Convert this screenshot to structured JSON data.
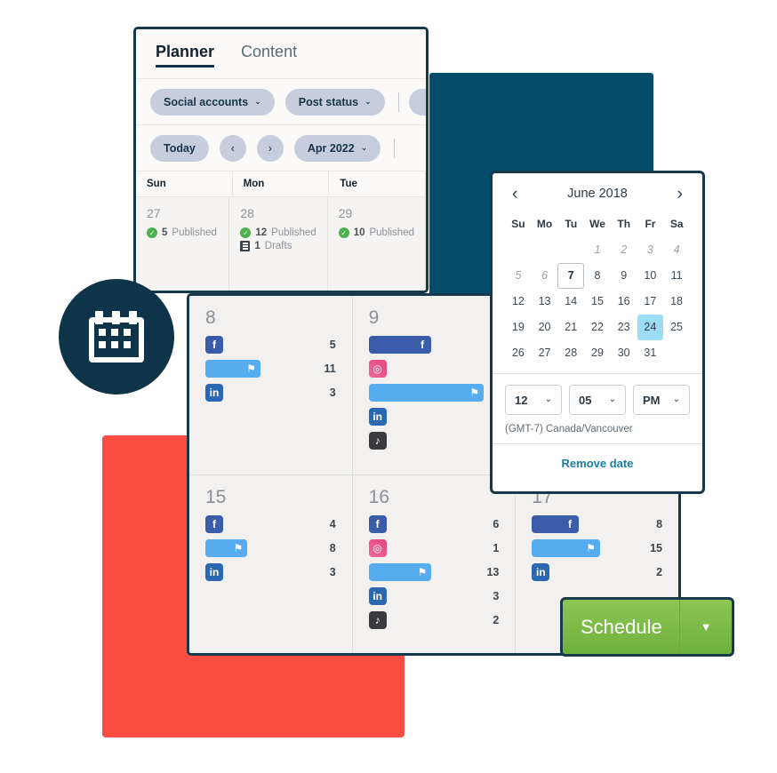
{
  "planner": {
    "tabs": [
      {
        "label": "Planner",
        "active": true
      },
      {
        "label": "Content",
        "active": false
      }
    ],
    "filters": [
      {
        "label": "Social accounts",
        "chevron": "⌄"
      },
      {
        "label": "Post status",
        "chevron": "⌄"
      }
    ],
    "nav": {
      "today_label": "Today",
      "prev_icon": "‹",
      "next_icon": "›",
      "month_label": "Apr 2022",
      "month_chevron": "⌄"
    },
    "weekday_headers": [
      "Sun",
      "Mon",
      "Tue"
    ],
    "days": [
      {
        "number": "27",
        "stats": [
          {
            "icon": "check-icon",
            "count": "5",
            "label": "Published"
          }
        ]
      },
      {
        "number": "28",
        "stats": [
          {
            "icon": "check-icon",
            "count": "12",
            "label": "Published"
          },
          {
            "icon": "draft-icon",
            "count": "1",
            "label": "Drafts"
          }
        ]
      },
      {
        "number": "29",
        "stats": [
          {
            "icon": "check-icon",
            "count": "10",
            "label": "Published"
          }
        ]
      }
    ]
  },
  "grid": {
    "cells": [
      {
        "day": "8",
        "rows": [
          {
            "network": "facebook",
            "count": "5",
            "bar_pct": 0
          },
          {
            "network": "twitter",
            "count": "11",
            "bar_pct": 42
          },
          {
            "network": "linkedin",
            "count": "3",
            "bar_pct": 0
          }
        ]
      },
      {
        "day": "9",
        "rows": [
          {
            "network": "facebook",
            "count": "",
            "bar_pct": 48
          },
          {
            "network": "instagram",
            "count": "",
            "bar_pct": 0
          },
          {
            "network": "twitter",
            "count": "",
            "bar_pct": 88
          },
          {
            "network": "linkedin",
            "count": "",
            "bar_pct": 0
          },
          {
            "network": "tiktok",
            "count": "",
            "bar_pct": 0
          }
        ]
      },
      {
        "day": "",
        "rows": []
      },
      {
        "day": "15",
        "rows": [
          {
            "network": "facebook",
            "count": "4",
            "bar_pct": 0
          },
          {
            "network": "twitter",
            "count": "8",
            "bar_pct": 32
          },
          {
            "network": "linkedin",
            "count": "3",
            "bar_pct": 0
          }
        ]
      },
      {
        "day": "16",
        "rows": [
          {
            "network": "facebook",
            "count": "6",
            "bar_pct": 0
          },
          {
            "network": "instagram",
            "count": "1",
            "bar_pct": 0
          },
          {
            "network": "twitter",
            "count": "13",
            "bar_pct": 48
          },
          {
            "network": "linkedin",
            "count": "3",
            "bar_pct": 0
          },
          {
            "network": "tiktok",
            "count": "2",
            "bar_pct": 0
          }
        ]
      },
      {
        "day": "17",
        "rows": [
          {
            "network": "facebook",
            "count": "8",
            "bar_pct": 36
          },
          {
            "network": "twitter",
            "count": "15",
            "bar_pct": 52
          },
          {
            "network": "linkedin",
            "count": "2",
            "bar_pct": 0
          }
        ]
      }
    ]
  },
  "datepicker": {
    "prev_icon": "‹",
    "next_icon": "›",
    "month_title": "June 2018",
    "weekdays": [
      "Su",
      "Mo",
      "Tu",
      "We",
      "Th",
      "Fr",
      "Sa"
    ],
    "days": [
      {
        "label": "",
        "state": "blank"
      },
      {
        "label": "",
        "state": "blank"
      },
      {
        "label": "",
        "state": "blank"
      },
      {
        "label": "1",
        "state": "mute"
      },
      {
        "label": "2",
        "state": "mute"
      },
      {
        "label": "3",
        "state": "mute"
      },
      {
        "label": "4",
        "state": "mute"
      },
      {
        "label": "5",
        "state": "mute"
      },
      {
        "label": "6",
        "state": "mute"
      },
      {
        "label": "7",
        "state": "today"
      },
      {
        "label": "8",
        "state": "normal"
      },
      {
        "label": "9",
        "state": "normal"
      },
      {
        "label": "10",
        "state": "normal"
      },
      {
        "label": "11",
        "state": "normal"
      },
      {
        "label": "12",
        "state": "normal"
      },
      {
        "label": "13",
        "state": "normal"
      },
      {
        "label": "14",
        "state": "normal"
      },
      {
        "label": "15",
        "state": "normal"
      },
      {
        "label": "16",
        "state": "normal"
      },
      {
        "label": "17",
        "state": "normal"
      },
      {
        "label": "18",
        "state": "normal"
      },
      {
        "label": "19",
        "state": "normal"
      },
      {
        "label": "20",
        "state": "normal"
      },
      {
        "label": "21",
        "state": "normal"
      },
      {
        "label": "22",
        "state": "normal"
      },
      {
        "label": "23",
        "state": "normal"
      },
      {
        "label": "24",
        "state": "sel"
      },
      {
        "label": "25",
        "state": "normal"
      },
      {
        "label": "26",
        "state": "normal"
      },
      {
        "label": "27",
        "state": "normal"
      },
      {
        "label": "28",
        "state": "normal"
      },
      {
        "label": "29",
        "state": "normal"
      },
      {
        "label": "30",
        "state": "normal"
      },
      {
        "label": "31",
        "state": "normal"
      },
      {
        "label": "",
        "state": "blank"
      }
    ],
    "time": {
      "hour": "12",
      "minute": "05",
      "meridiem": "PM",
      "chevron": "⌄"
    },
    "timezone": "(GMT-7) Canada/Vancouver",
    "remove_label": "Remove date"
  },
  "schedule_button": {
    "label": "Schedule",
    "caret": "▼"
  },
  "colors": {
    "navy_block": "#034d6b",
    "red_block": "#fb4d42",
    "card_border": "#16394b",
    "badge_circle": "#0d3449",
    "pill": "#c6cddc",
    "published_green": "#4caf50",
    "selected_day": "#9ddcf6",
    "link_teal": "#1b7ea6",
    "schedule_green": "#7dbe4a",
    "facebook": "#3b5ca9",
    "twitter": "#55acee",
    "linkedin": "#2a69b2",
    "instagram": "#e4447d",
    "tiktok": "#3b3b3f"
  },
  "icon_glyphs": {
    "facebook": "f",
    "twitter": "⚑",
    "linkedin": "in",
    "instagram": "◎",
    "tiktok": "♪",
    "check": "✓",
    "calendar": "calendar-icon"
  }
}
